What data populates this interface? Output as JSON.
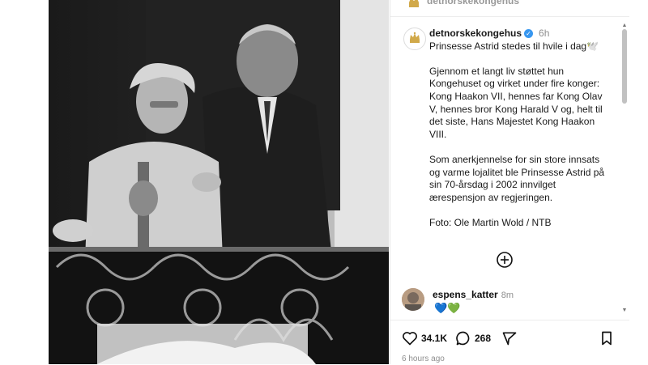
{
  "post": {
    "username": "detnorskekongehus",
    "top_username": "detnorskekongehus",
    "time": "6h",
    "caption": [
      "Prinsesse Astrid stedes til hvile i dag🕊️",
      "Gjennom et langt liv støttet hun Kongehuset og virket under fire konger: Kong Haakon VII, hennes far Kong Olav V, hennes bror Kong Harald V og, helt til det siste, Hans Majestet Kong Haakon VIII.",
      "Som anerkjennelse for sin store innsats og varme lojalitet ble Prinsesse Astrid på sin 70-årsdag i 2002 innvilget ærespensjon av regjeringen.",
      "Foto: Ole Martin Wold / NTB"
    ]
  },
  "comment": {
    "username": "espens_katter",
    "time": "8m",
    "text": "💙💚"
  },
  "actions": {
    "likes": "34.1K",
    "comments": "268"
  },
  "posted_ago": "6 hours ago",
  "icons": {
    "verified": "verified-badge-icon",
    "more": "plus-circle-icon",
    "like": "heart-icon",
    "comment": "comment-bubble-icon",
    "share": "paper-plane-icon",
    "save": "bookmark-icon"
  },
  "colors": {
    "verified": "#3897f0",
    "muted": "#8e8e8e"
  }
}
